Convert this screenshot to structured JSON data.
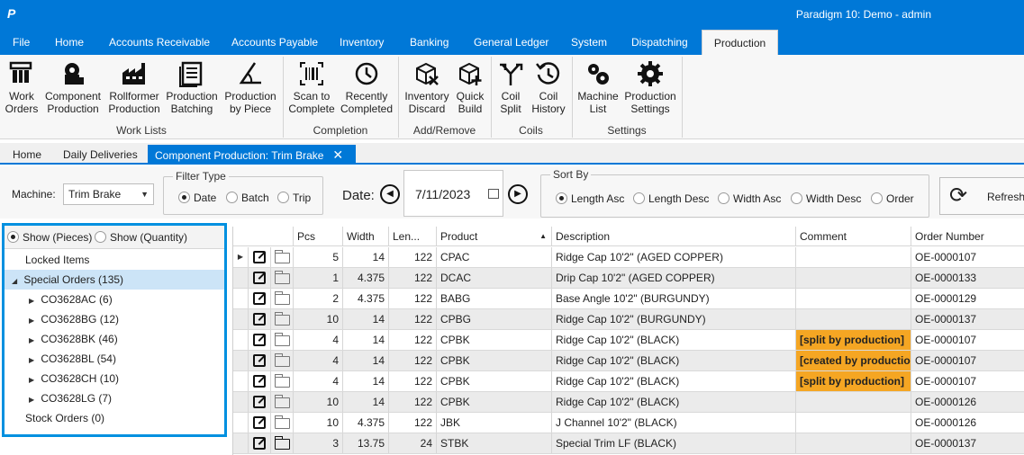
{
  "app": {
    "logo": "P",
    "window_title": "Paradigm 10: Demo - admin"
  },
  "menu": {
    "tabs": [
      "File",
      "Home",
      "Accounts Receivable",
      "Accounts Payable",
      "Inventory",
      "Banking",
      "General Ledger",
      "System",
      "Dispatching",
      "Production"
    ],
    "active": "Production"
  },
  "ribbon": {
    "buttons": [
      {
        "line1": "Work",
        "line2": "Orders",
        "icon": "work-orders-icon"
      },
      {
        "line1": "Component",
        "line2": "Production",
        "icon": "component-production-icon"
      },
      {
        "line1": "Rollformer",
        "line2": "Production",
        "icon": "factory-icon"
      },
      {
        "line1": "Production",
        "line2": "Batching",
        "icon": "batch-list-icon"
      },
      {
        "line1": "Production",
        "line2": "by Piece",
        "icon": "angle-icon"
      },
      {
        "line1": "Scan to",
        "line2": "Complete",
        "icon": "barcode-icon"
      },
      {
        "line1": "Recently",
        "line2": "Completed",
        "icon": "clock-history-icon"
      },
      {
        "line1": "Inventory",
        "line2": "Discard",
        "icon": "box-discard-icon"
      },
      {
        "line1": "Quick",
        "line2": "Build",
        "icon": "box-add-icon"
      },
      {
        "line1": "Coil",
        "line2": "Split",
        "icon": "split-arrows-icon"
      },
      {
        "line1": "Coil",
        "line2": "History",
        "icon": "coil-history-icon"
      },
      {
        "line1": "Machine",
        "line2": "List",
        "icon": "gears-icon"
      },
      {
        "line1": "Production",
        "line2": "Settings",
        "icon": "settings-gear-icon"
      }
    ],
    "groups": [
      "Work Lists",
      "Completion",
      "Add/Remove",
      "Coils",
      "Settings"
    ]
  },
  "doc_tabs": {
    "tabs": [
      "Home",
      "Daily Deliveries",
      "Component Production: Trim Brake"
    ],
    "close": "✕"
  },
  "filters": {
    "machine_label": "Machine:",
    "machine_value": "Trim Brake",
    "filter_type_legend": "Filter Type",
    "filter_types": [
      "Date",
      "Batch",
      "Trip"
    ],
    "filter_type_selected": "Date",
    "date_label": "Date:",
    "date_value": "7/11/2023",
    "sort_by_legend": "Sort By",
    "sort_options": [
      "Length Asc",
      "Length Desc",
      "Width Asc",
      "Width Desc",
      "Order"
    ],
    "sort_selected": "Length Asc",
    "refresh_label": "Refresh"
  },
  "tree": {
    "show_options": [
      "Show (Pieces)",
      "Show (Quantity)"
    ],
    "show_selected": "Show (Pieces)",
    "items": [
      {
        "label": "Locked Items",
        "level": 0,
        "toggle": ""
      },
      {
        "label": "Special Orders (135)",
        "level": 0,
        "toggle": "◢"
      },
      {
        "label": "CO3628AC (6)",
        "level": 1,
        "toggle": "▶"
      },
      {
        "label": "CO3628BG (12)",
        "level": 1,
        "toggle": "▶"
      },
      {
        "label": "CO3628BK (46)",
        "level": 1,
        "toggle": "▶"
      },
      {
        "label": "CO3628BL (54)",
        "level": 1,
        "toggle": "▶"
      },
      {
        "label": "CO3628CH (10)",
        "level": 1,
        "toggle": "▶"
      },
      {
        "label": "CO3628LG (7)",
        "level": 1,
        "toggle": "▶"
      },
      {
        "label": "Stock Orders (0)",
        "level": 0,
        "toggle": ""
      }
    ],
    "selected": "Special Orders (135)"
  },
  "grid": {
    "columns": [
      "Pcs",
      "Width",
      "Len...",
      "Product",
      "Description",
      "Comment",
      "Order Number"
    ],
    "rows": [
      {
        "pcs": "5",
        "width": "14",
        "len": "122",
        "product": "CPAC",
        "description": "Ridge Cap 10'2\" (AGED COPPER)",
        "comment": "",
        "order": "OE-0000107"
      },
      {
        "pcs": "1",
        "width": "4.375",
        "len": "122",
        "product": "DCAC",
        "description": "Drip Cap 10'2\" (AGED COPPER)",
        "comment": "",
        "order": "OE-0000133"
      },
      {
        "pcs": "2",
        "width": "4.375",
        "len": "122",
        "product": "BABG",
        "description": "Base Angle 10'2\" (BURGUNDY)",
        "comment": "",
        "order": "OE-0000129"
      },
      {
        "pcs": "10",
        "width": "14",
        "len": "122",
        "product": "CPBG",
        "description": "Ridge Cap 10'2\" (BURGUNDY)",
        "comment": "",
        "order": "OE-0000137"
      },
      {
        "pcs": "4",
        "width": "14",
        "len": "122",
        "product": "CPBK",
        "description": "Ridge Cap 10'2\" (BLACK)",
        "comment": "[split by production]",
        "order": "OE-0000107"
      },
      {
        "pcs": "4",
        "width": "14",
        "len": "122",
        "product": "CPBK",
        "description": "Ridge Cap 10'2\" (BLACK)",
        "comment": "[created by productio",
        "order": "OE-0000107"
      },
      {
        "pcs": "4",
        "width": "14",
        "len": "122",
        "product": "CPBK",
        "description": "Ridge Cap 10'2\" (BLACK)",
        "comment": "[split by production]",
        "order": "OE-0000107"
      },
      {
        "pcs": "10",
        "width": "14",
        "len": "122",
        "product": "CPBK",
        "description": "Ridge Cap 10'2\" (BLACK)",
        "comment": "",
        "order": "OE-0000126"
      },
      {
        "pcs": "10",
        "width": "4.375",
        "len": "122",
        "product": "JBK",
        "description": "J Channel 10'2\" (BLACK)",
        "comment": "",
        "order": "OE-0000126"
      },
      {
        "pcs": "3",
        "width": "13.75",
        "len": "24",
        "product": "STBK",
        "description": "Special Trim LF (BLACK)",
        "comment": "",
        "order": "OE-0000137"
      }
    ],
    "current_row_marker": "▶",
    "comment_highlight_color": "#f5a623"
  },
  "colors": {
    "accent": "#0078d7",
    "panel_border": "#0090e0"
  }
}
